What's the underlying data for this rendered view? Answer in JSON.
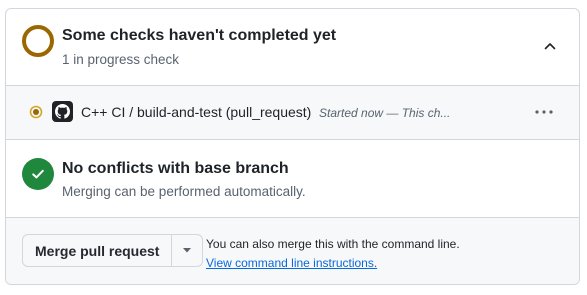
{
  "checks": {
    "title": "Some checks haven't completed yet",
    "subtitle": "1 in progress check",
    "items": [
      {
        "name": "C++ CI / build-and-test (pull_request)",
        "description": "Started now — This ch..."
      }
    ]
  },
  "conflicts": {
    "title": "No conflicts with base branch",
    "subtitle": "Merging can be performed automatically."
  },
  "merge": {
    "button_label": "Merge pull request",
    "cli_text": "You can also merge this with the command line.",
    "cli_link": "View command line instructions."
  },
  "colors": {
    "pending": "#9a6700",
    "success": "#1f883d",
    "link": "#0969da",
    "border": "#d0d7de",
    "muted_bg": "#f6f8fa"
  },
  "icons": {
    "pending_status": "pending-ring-icon",
    "collapse": "chevron-up-icon",
    "row_status": "in-progress-dot-icon",
    "app_avatar": "github-actions-icon",
    "row_menu": "kebab-horizontal-icon",
    "success_status": "check-circle-icon",
    "merge_dropdown": "triangle-down-icon"
  }
}
